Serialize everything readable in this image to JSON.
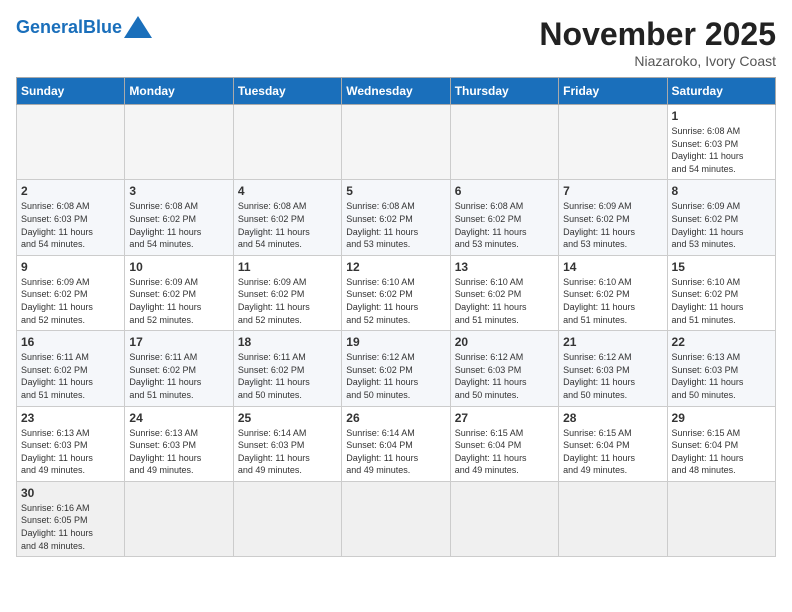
{
  "header": {
    "logo_general": "General",
    "logo_blue": "Blue",
    "month_title": "November 2025",
    "location": "Niazaroko, Ivory Coast"
  },
  "days_of_week": [
    "Sunday",
    "Monday",
    "Tuesday",
    "Wednesday",
    "Thursday",
    "Friday",
    "Saturday"
  ],
  "weeks": [
    [
      {
        "day": "",
        "info": ""
      },
      {
        "day": "",
        "info": ""
      },
      {
        "day": "",
        "info": ""
      },
      {
        "day": "",
        "info": ""
      },
      {
        "day": "",
        "info": ""
      },
      {
        "day": "",
        "info": ""
      },
      {
        "day": "1",
        "info": "Sunrise: 6:08 AM\nSunset: 6:03 PM\nDaylight: 11 hours\nand 54 minutes."
      }
    ],
    [
      {
        "day": "2",
        "info": "Sunrise: 6:08 AM\nSunset: 6:03 PM\nDaylight: 11 hours\nand 54 minutes."
      },
      {
        "day": "3",
        "info": "Sunrise: 6:08 AM\nSunset: 6:02 PM\nDaylight: 11 hours\nand 54 minutes."
      },
      {
        "day": "4",
        "info": "Sunrise: 6:08 AM\nSunset: 6:02 PM\nDaylight: 11 hours\nand 54 minutes."
      },
      {
        "day": "5",
        "info": "Sunrise: 6:08 AM\nSunset: 6:02 PM\nDaylight: 11 hours\nand 53 minutes."
      },
      {
        "day": "6",
        "info": "Sunrise: 6:08 AM\nSunset: 6:02 PM\nDaylight: 11 hours\nand 53 minutes."
      },
      {
        "day": "7",
        "info": "Sunrise: 6:09 AM\nSunset: 6:02 PM\nDaylight: 11 hours\nand 53 minutes."
      },
      {
        "day": "8",
        "info": "Sunrise: 6:09 AM\nSunset: 6:02 PM\nDaylight: 11 hours\nand 53 minutes."
      }
    ],
    [
      {
        "day": "9",
        "info": "Sunrise: 6:09 AM\nSunset: 6:02 PM\nDaylight: 11 hours\nand 52 minutes."
      },
      {
        "day": "10",
        "info": "Sunrise: 6:09 AM\nSunset: 6:02 PM\nDaylight: 11 hours\nand 52 minutes."
      },
      {
        "day": "11",
        "info": "Sunrise: 6:09 AM\nSunset: 6:02 PM\nDaylight: 11 hours\nand 52 minutes."
      },
      {
        "day": "12",
        "info": "Sunrise: 6:10 AM\nSunset: 6:02 PM\nDaylight: 11 hours\nand 52 minutes."
      },
      {
        "day": "13",
        "info": "Sunrise: 6:10 AM\nSunset: 6:02 PM\nDaylight: 11 hours\nand 51 minutes."
      },
      {
        "day": "14",
        "info": "Sunrise: 6:10 AM\nSunset: 6:02 PM\nDaylight: 11 hours\nand 51 minutes."
      },
      {
        "day": "15",
        "info": "Sunrise: 6:10 AM\nSunset: 6:02 PM\nDaylight: 11 hours\nand 51 minutes."
      }
    ],
    [
      {
        "day": "16",
        "info": "Sunrise: 6:11 AM\nSunset: 6:02 PM\nDaylight: 11 hours\nand 51 minutes."
      },
      {
        "day": "17",
        "info": "Sunrise: 6:11 AM\nSunset: 6:02 PM\nDaylight: 11 hours\nand 51 minutes."
      },
      {
        "day": "18",
        "info": "Sunrise: 6:11 AM\nSunset: 6:02 PM\nDaylight: 11 hours\nand 50 minutes."
      },
      {
        "day": "19",
        "info": "Sunrise: 6:12 AM\nSunset: 6:02 PM\nDaylight: 11 hours\nand 50 minutes."
      },
      {
        "day": "20",
        "info": "Sunrise: 6:12 AM\nSunset: 6:03 PM\nDaylight: 11 hours\nand 50 minutes."
      },
      {
        "day": "21",
        "info": "Sunrise: 6:12 AM\nSunset: 6:03 PM\nDaylight: 11 hours\nand 50 minutes."
      },
      {
        "day": "22",
        "info": "Sunrise: 6:13 AM\nSunset: 6:03 PM\nDaylight: 11 hours\nand 50 minutes."
      }
    ],
    [
      {
        "day": "23",
        "info": "Sunrise: 6:13 AM\nSunset: 6:03 PM\nDaylight: 11 hours\nand 49 minutes."
      },
      {
        "day": "24",
        "info": "Sunrise: 6:13 AM\nSunset: 6:03 PM\nDaylight: 11 hours\nand 49 minutes."
      },
      {
        "day": "25",
        "info": "Sunrise: 6:14 AM\nSunset: 6:03 PM\nDaylight: 11 hours\nand 49 minutes."
      },
      {
        "day": "26",
        "info": "Sunrise: 6:14 AM\nSunset: 6:04 PM\nDaylight: 11 hours\nand 49 minutes."
      },
      {
        "day": "27",
        "info": "Sunrise: 6:15 AM\nSunset: 6:04 PM\nDaylight: 11 hours\nand 49 minutes."
      },
      {
        "day": "28",
        "info": "Sunrise: 6:15 AM\nSunset: 6:04 PM\nDaylight: 11 hours\nand 49 minutes."
      },
      {
        "day": "29",
        "info": "Sunrise: 6:15 AM\nSunset: 6:04 PM\nDaylight: 11 hours\nand 48 minutes."
      }
    ],
    [
      {
        "day": "30",
        "info": "Sunrise: 6:16 AM\nSunset: 6:05 PM\nDaylight: 11 hours\nand 48 minutes."
      },
      {
        "day": "",
        "info": ""
      },
      {
        "day": "",
        "info": ""
      },
      {
        "day": "",
        "info": ""
      },
      {
        "day": "",
        "info": ""
      },
      {
        "day": "",
        "info": ""
      },
      {
        "day": "",
        "info": ""
      }
    ]
  ]
}
